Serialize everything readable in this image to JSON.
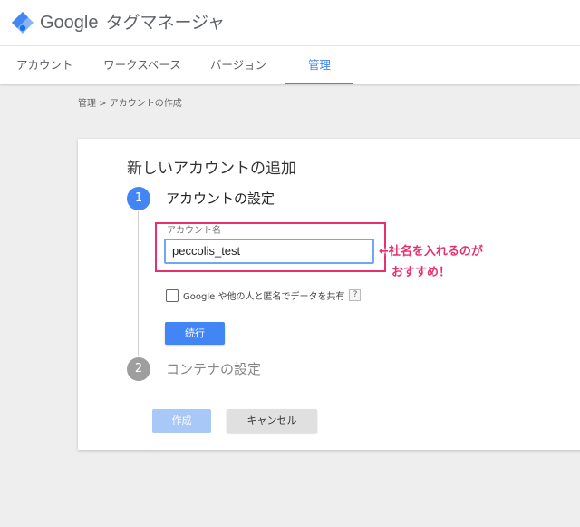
{
  "app": {
    "brand": "Google",
    "product": "タグマネージャ"
  },
  "nav": {
    "tabs": [
      {
        "label": "アカウント",
        "active": false
      },
      {
        "label": "ワークスペース",
        "active": false
      },
      {
        "label": "バージョン",
        "active": false
      },
      {
        "label": "管理",
        "active": true
      }
    ]
  },
  "breadcrumb": "管理 > アカウントの作成",
  "card": {
    "title": "新しいアカウントの追加",
    "step1": {
      "number": "1",
      "title": "アカウントの設定",
      "field_label": "アカウント名",
      "field_value": "peccolis_test",
      "checkbox_label": "Google や他の人と匿名でデータを共有",
      "help_badge": "?",
      "continue_label": "続行"
    },
    "step2": {
      "number": "2",
      "title": "コンテナの設定"
    },
    "create_label": "作成",
    "cancel_label": "キャンセル"
  },
  "annotation": {
    "line1": "←社名を入れるのが",
    "line2": "おすすめ！",
    "color": "#e8306e"
  },
  "colors": {
    "accent": "#4285f4",
    "disabled_accent": "#a8c8f8",
    "highlight": "#e8306e"
  }
}
